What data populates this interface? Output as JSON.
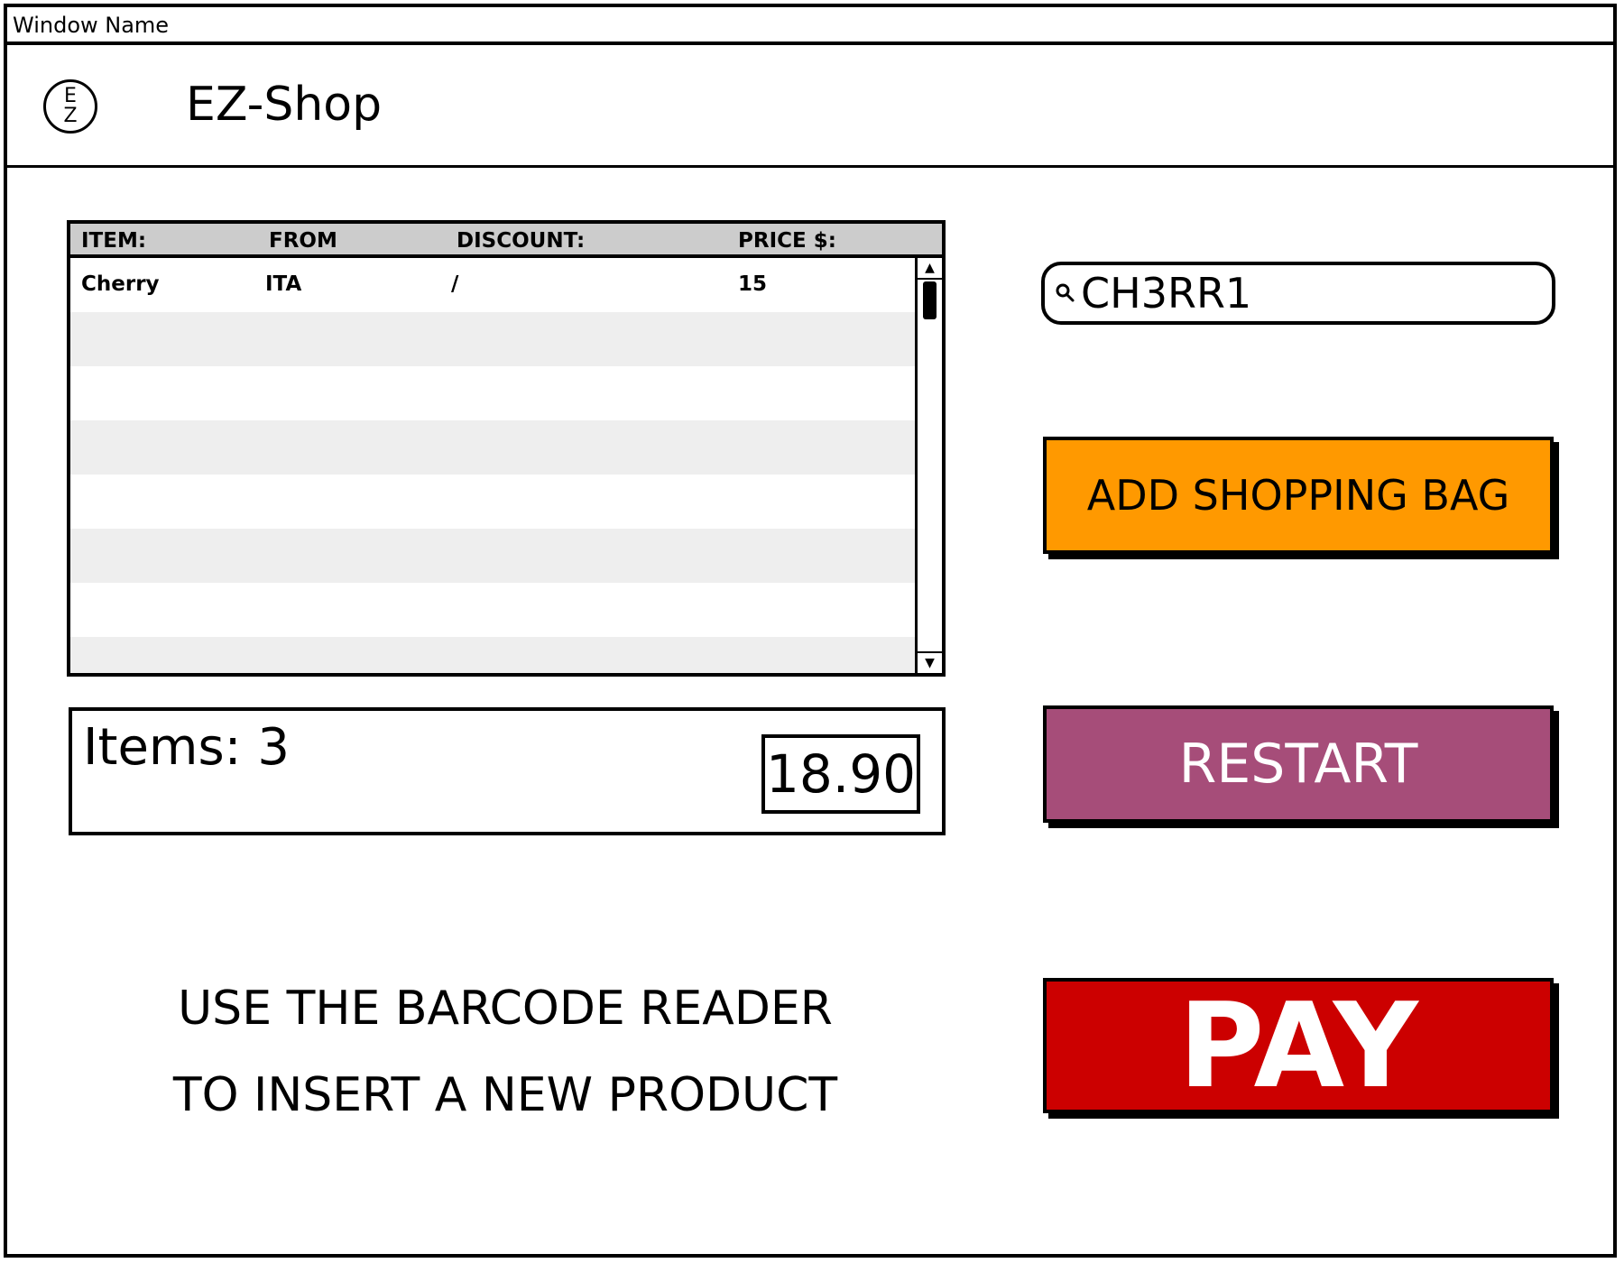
{
  "window": {
    "title": "Window Name"
  },
  "header": {
    "logo_top": "E",
    "logo_bottom": "Z",
    "app_title": "EZ-Shop"
  },
  "table": {
    "columns": [
      "ITEM:",
      "FROM",
      "DISCOUNT:",
      "PRICE $:"
    ],
    "rows": [
      {
        "item": "Cherry",
        "from": "ITA",
        "discount": "/",
        "price": "15"
      }
    ]
  },
  "summary": {
    "items_label": "Items: 3",
    "total": "18.90"
  },
  "instructions": {
    "line1": "USE THE BARCODE READER",
    "line2": "TO INSERT A NEW PRODUCT"
  },
  "search": {
    "value": "CH3RR1"
  },
  "buttons": {
    "add": "ADD SHOPPING BAG",
    "restart": "RESTART",
    "pay": "PAY"
  },
  "colors": {
    "add": "#ff9900",
    "restart": "#a64d79",
    "pay": "#cc0000",
    "table_header": "#cccccc",
    "row_alt": "#eeeeee"
  }
}
